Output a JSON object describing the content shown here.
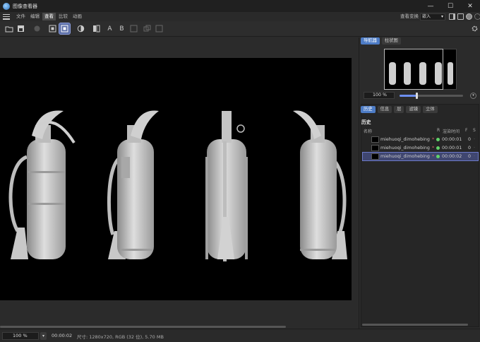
{
  "window": {
    "title": "图像查看器",
    "controls": [
      "—",
      "☐",
      "✕"
    ]
  },
  "menu": {
    "items": [
      "文件",
      "编辑",
      "查看",
      "比较",
      "动画"
    ],
    "active_index": 2
  },
  "view_mode": {
    "label": "查看变换",
    "value": "嵌入"
  },
  "toolbar": {
    "text_tool_a": "A",
    "text_tool_b": "B"
  },
  "right_tabs": {
    "navigator": "导航器",
    "histogram": "柱状图"
  },
  "navigator": {
    "zoom": "100 %",
    "zoom_level": 0.27
  },
  "info_tabs": [
    "历史",
    "信息",
    "层",
    "滤镜",
    "立体"
  ],
  "history": {
    "title": "历史",
    "columns": {
      "name": "名称",
      "r": "R",
      "render_time": "渲染时间",
      "f": "F",
      "s": "S"
    },
    "rows": [
      {
        "name": "miehuoqi_dimohebing",
        "time": "00:00:01",
        "f": "0",
        "selected": false
      },
      {
        "name": "miehuoqi_dimohebing",
        "time": "00:00:01",
        "f": "0",
        "selected": false
      },
      {
        "name": "miehuoqi_dimohebing",
        "time": "00:00:02",
        "f": "0",
        "selected": true
      }
    ]
  },
  "status": {
    "zoom": "100 %",
    "time": "00:00:02",
    "info": "尺寸: 1280x720, RGB (32 位), 5.70 MB"
  }
}
